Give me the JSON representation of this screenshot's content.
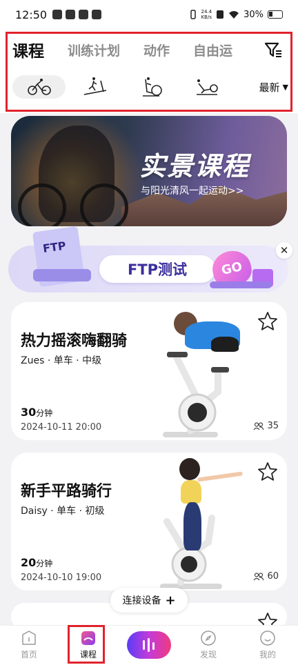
{
  "status_bar": {
    "time": "12:50",
    "net_speed": "24.4",
    "net_unit": "KB/s",
    "battery": "30%"
  },
  "tabs": [
    "课程",
    "训练计划",
    "动作",
    "自由运"
  ],
  "categories": [
    {
      "icon": "bike-icon",
      "active": true
    },
    {
      "icon": "treadmill-icon",
      "active": false
    },
    {
      "icon": "elliptical-icon",
      "active": false
    },
    {
      "icon": "rowing-icon",
      "active": false
    }
  ],
  "sort_label": "最新",
  "banner": {
    "title": "实景课程",
    "subtitle": "与阳光清风一起运动>>"
  },
  "ftp": {
    "button_label": "FTP测试",
    "doc_label": "FTP",
    "heart_label": "GO"
  },
  "courses": [
    {
      "title": "热力摇滚嗨翻骑",
      "meta": "Zues · 单车 · 中级",
      "duration": "30",
      "duration_unit": "分钟",
      "date": "2024-10-11 20:00",
      "participants": "35"
    },
    {
      "title": "新手平路骑行",
      "meta": "Daisy · 单车 · 初级",
      "duration": "20",
      "duration_unit": "分钟",
      "date": "2024-10-10 19:00",
      "participants": "60"
    }
  ],
  "connect_label": "连接设备",
  "nav": [
    "首页",
    "课程",
    "发现",
    "我的"
  ],
  "colors": {
    "accent_red": "#e0222c",
    "ftp_purple": "#3b2f9c",
    "play_gradient": [
      "#5a3df5",
      "#c33bd9",
      "#f03a7f"
    ]
  }
}
